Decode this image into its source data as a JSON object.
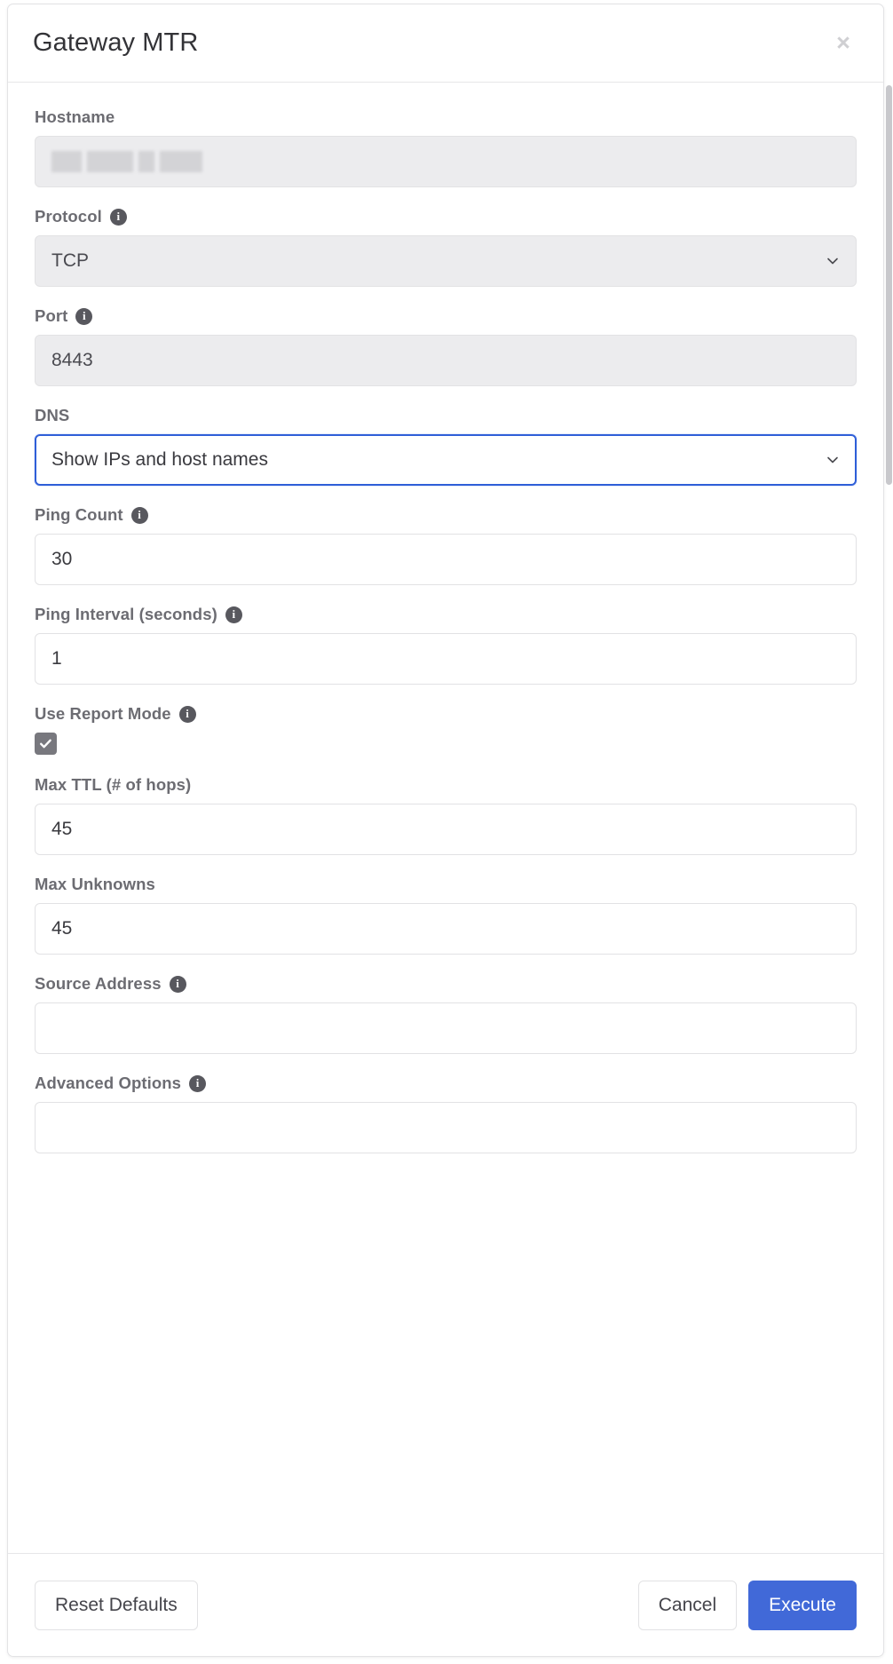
{
  "dialog": {
    "title": "Gateway MTR",
    "close_label": "×"
  },
  "fields": {
    "hostname": {
      "label": "Hostname",
      "value": "",
      "redacted": true,
      "disabled": true,
      "has_info": false
    },
    "protocol": {
      "label": "Protocol",
      "value": "TCP",
      "disabled": true,
      "has_info": true,
      "type": "select",
      "options": [
        "TCP"
      ]
    },
    "port": {
      "label": "Port",
      "value": "8443",
      "disabled": true,
      "has_info": true,
      "type": "text"
    },
    "dns": {
      "label": "DNS",
      "value": "Show IPs and host names",
      "disabled": false,
      "focused": true,
      "has_info": false,
      "type": "select",
      "options": [
        "Show IPs and host names"
      ]
    },
    "ping_count": {
      "label": "Ping Count",
      "value": "30",
      "disabled": false,
      "has_info": true,
      "type": "text"
    },
    "ping_interval": {
      "label": "Ping Interval (seconds)",
      "value": "1",
      "disabled": false,
      "has_info": true,
      "type": "text"
    },
    "use_report_mode": {
      "label": "Use Report Mode",
      "checked": true,
      "has_info": true,
      "type": "checkbox"
    },
    "max_ttl": {
      "label": "Max TTL (# of hops)",
      "value": "45",
      "disabled": false,
      "has_info": false,
      "type": "text"
    },
    "max_unknowns": {
      "label": "Max Unknowns",
      "value": "45",
      "disabled": false,
      "has_info": false,
      "type": "text"
    },
    "source_address": {
      "label": "Source Address",
      "value": "",
      "placeholder": "",
      "disabled": false,
      "has_info": true,
      "type": "text"
    },
    "advanced_options": {
      "label": "Advanced Options",
      "value": "",
      "placeholder": "",
      "disabled": false,
      "has_info": true,
      "type": "text"
    }
  },
  "footer": {
    "reset_label": "Reset Defaults",
    "cancel_label": "Cancel",
    "execute_label": "Execute"
  },
  "icons": {
    "info": "i",
    "chevron_down": "chevron-down-icon",
    "check": "check-icon",
    "close": "close-icon"
  },
  "colors": {
    "primary": "#4169d8",
    "focus_border": "#2f5fd8",
    "label_text": "#6c6c72",
    "disabled_bg": "#ececee",
    "info_icon_bg": "#58585e",
    "checkbox_bg": "#78787e"
  }
}
